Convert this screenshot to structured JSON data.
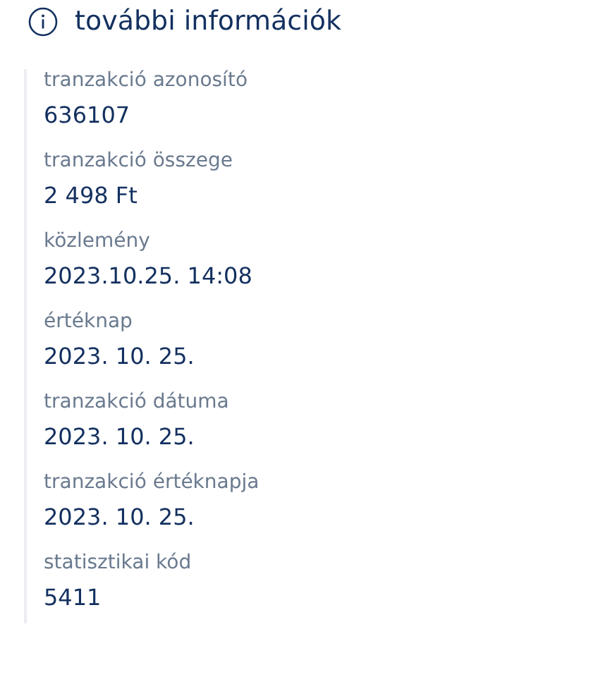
{
  "header": {
    "title": "további információk"
  },
  "fields": [
    {
      "label": "tranzakció azonosító",
      "value": "636107"
    },
    {
      "label": "tranzakció összege",
      "value": "2 498 Ft"
    },
    {
      "label": "közlemény",
      "value": "2023.10.25. 14:08"
    },
    {
      "label": "értéknap",
      "value": "2023. 10. 25."
    },
    {
      "label": "tranzakció dátuma",
      "value": "2023. 10. 25."
    },
    {
      "label": "tranzakció értéknapja",
      "value": "2023. 10. 25."
    },
    {
      "label": "statisztikai kód",
      "value": "5411"
    }
  ]
}
